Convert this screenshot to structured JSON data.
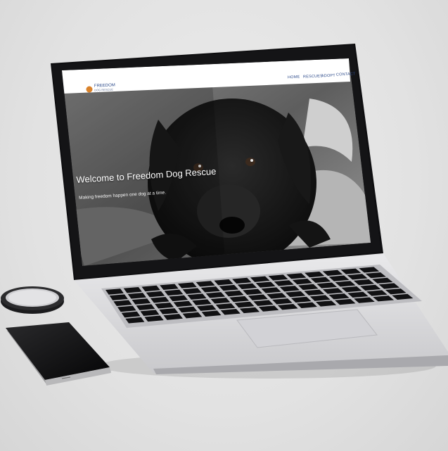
{
  "site": {
    "logo_title": "FREEDOM",
    "logo_subtitle": "DOG RESCUE",
    "nav": [
      "HOME",
      "RESCUES",
      "ADOPT",
      "CONTACT"
    ],
    "hero_title": "Welcome to Freedom Dog Rescue",
    "hero_subtitle": "Making freedom happen one dog at a time."
  },
  "colors": {
    "nav_link": "#2c4a8a",
    "logo_accent": "#d9822b",
    "laptop_body": "#d9d9db",
    "bezel": "#0e0e10"
  }
}
